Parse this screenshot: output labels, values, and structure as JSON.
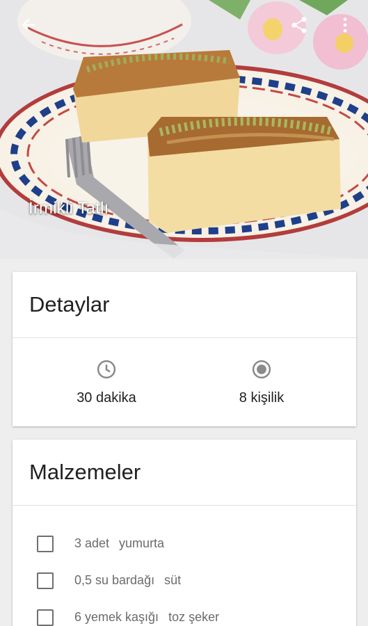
{
  "header": {
    "title": "İrmikli Tatlı",
    "back_icon": "arrow-back-icon",
    "share_icon": "share-icon",
    "more_icon": "more-vert-icon"
  },
  "details": {
    "title": "Detaylar",
    "time": {
      "icon": "clock-icon",
      "text": "30 dakika"
    },
    "servings": {
      "icon": "radio-target-icon",
      "text": "8 kişilik"
    }
  },
  "ingredients": {
    "title": "Malzemeler",
    "items": [
      {
        "amount": "3 adet",
        "name": "yumurta"
      },
      {
        "amount": "0,5 su bardağı",
        "name": "süt"
      },
      {
        "amount": "6 yemek kaşığı",
        "name": "toz şeker"
      }
    ]
  },
  "colors": {
    "accent_icon": "#8a8a8a",
    "text_primary": "#212121",
    "text_secondary": "#6b6b6b"
  }
}
